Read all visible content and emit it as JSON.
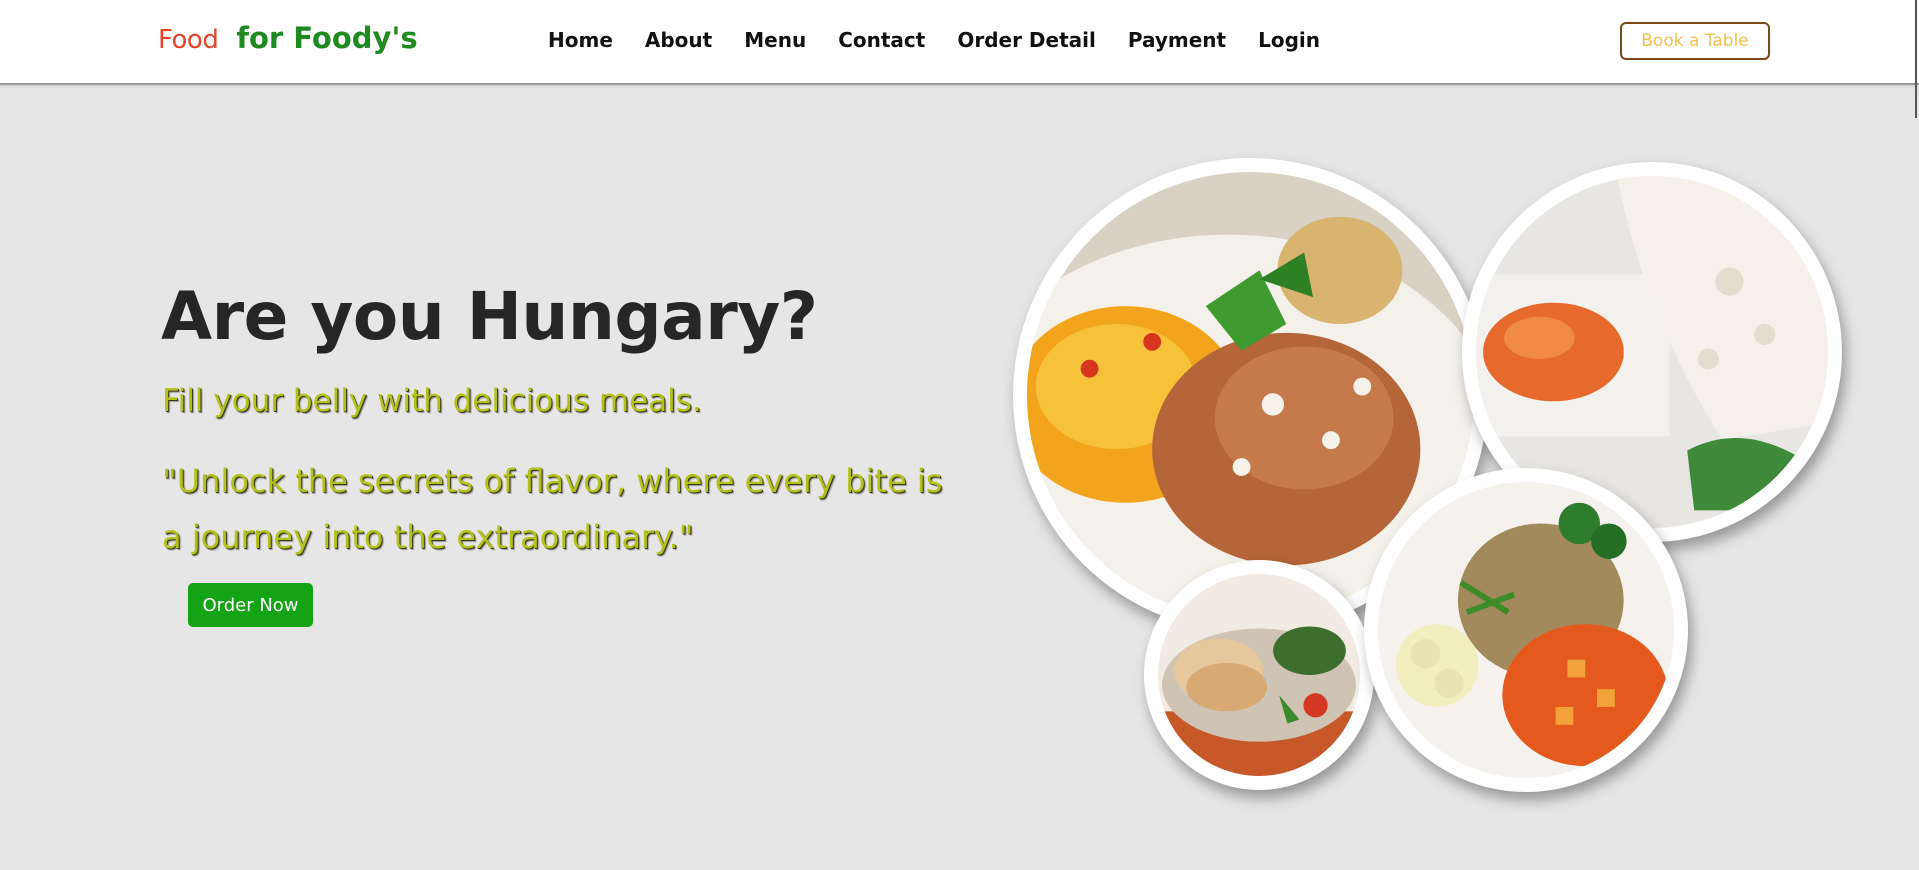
{
  "header": {
    "logo_mark": "Food",
    "logo_text": "for Foody's",
    "nav": [
      "Home",
      "About",
      "Menu",
      "Contact",
      "Order Detail",
      "Payment",
      "Login"
    ],
    "book_label": "Book a Table"
  },
  "hero": {
    "title": "Are you Hungary?",
    "subtitle": "Fill your belly with delicious meals.",
    "quote": "\"Unlock the secrets of flavor, where every bite is a journey into the extraordinary.\"",
    "order_label": "Order Now"
  },
  "images": [
    {
      "name": "rice-curry-plate-image"
    },
    {
      "name": "dosa-curry-image"
    },
    {
      "name": "naan-platter-image"
    },
    {
      "name": "veg-rice-bowl-image"
    }
  ],
  "colors": {
    "background": "#e6e6e6",
    "brand_green": "#1f8a1f",
    "logo_red": "#e8442c",
    "accent_yellow": "#f2bf4d",
    "tagline_lime": "#b3c21a",
    "order_button": "#14a314"
  }
}
